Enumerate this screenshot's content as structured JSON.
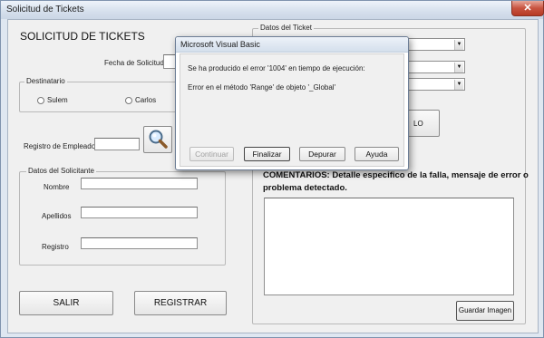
{
  "window": {
    "title": "Solicitud de Tickets",
    "close_glyph": "✕"
  },
  "form": {
    "heading": "SOLICITUD DE TICKETS",
    "fecha_label": "Fecha de Solicitud",
    "destinatario": {
      "caption": "Destinatario",
      "options": [
        "Sulem",
        "Carlos"
      ]
    },
    "registro_empleado_label": "Registro de Empleado",
    "search_icon": "magnifier-icon",
    "solicitante": {
      "caption": "Datos del Solicitante",
      "nombre": "Nombre",
      "apellidos": "Apellidos",
      "registro": "Registro"
    },
    "salir_label": "SALIR",
    "registrar_label": "REGISTRAR"
  },
  "ticket": {
    "caption": "Datos del Ticket",
    "partial_button_text": "LO",
    "comentarios_line1": "COMENTARIOS: Detalle especifico de la falla, mensaje de error o",
    "comentarios_line2": "problema detectado.",
    "guardar_label": "Guardar Imagen"
  },
  "dialog": {
    "title": "Microsoft Visual Basic",
    "message1": "Se ha producido el error '1004' en tiempo de ejecución:",
    "message2": "Error en el método 'Range' de objeto '_Global'",
    "buttons": {
      "continuar": "Continuar",
      "finalizar": "Finalizar",
      "depurar": "Depurar",
      "ayuda": "Ayuda"
    }
  },
  "colors": {
    "title_bar": "#d5dfec",
    "close_button": "#c85440",
    "form_bg": "#f0f0f0",
    "dialog_bg": "#f0f0f0"
  }
}
